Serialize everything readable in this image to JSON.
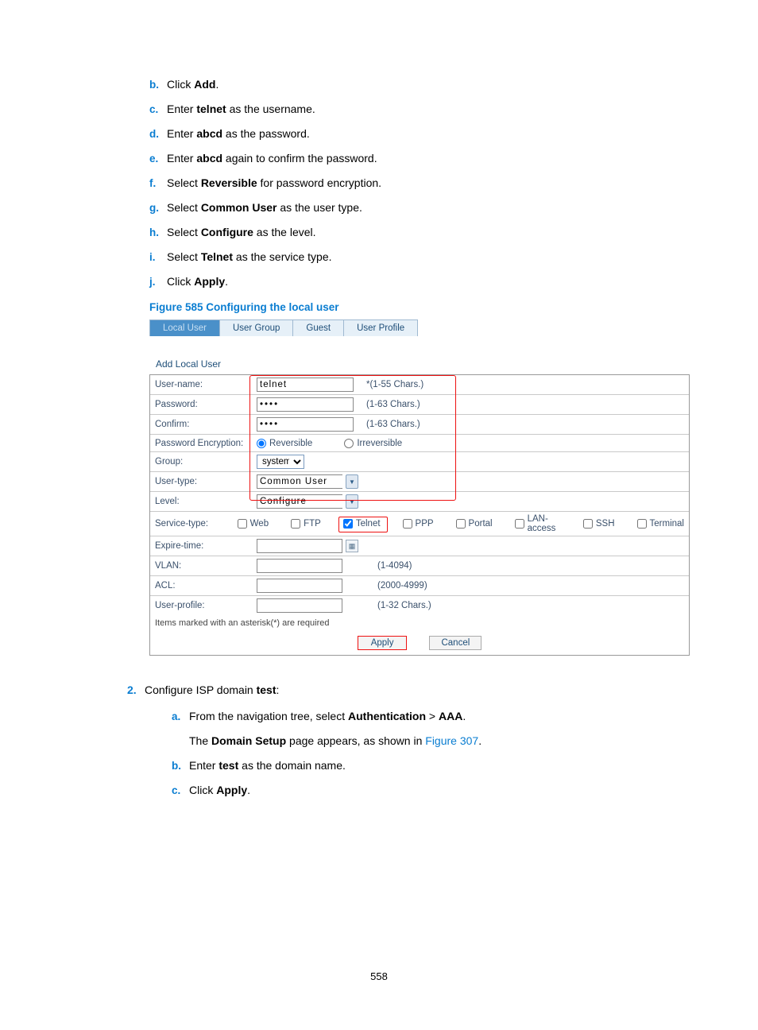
{
  "steps_first": [
    {
      "marker": "b.",
      "pre": "Click ",
      "bold": "Add",
      "post": "."
    },
    {
      "marker": "c.",
      "pre": "Enter ",
      "bold": "telnet",
      "post": " as the username."
    },
    {
      "marker": "d.",
      "pre": "Enter ",
      "bold": "abcd",
      "post": " as the password."
    },
    {
      "marker": "e.",
      "pre": "Enter ",
      "bold": "abcd",
      "post": " again to confirm the password."
    },
    {
      "marker": "f.",
      "pre": "Select ",
      "bold": "Reversible",
      "post": " for password encryption."
    },
    {
      "marker": "g.",
      "pre": "Select ",
      "bold": "Common User",
      "post": " as the user type."
    },
    {
      "marker": "h.",
      "pre": "Select ",
      "bold": "Configure",
      "post": " as the level."
    },
    {
      "marker": "i.",
      "pre": "Select ",
      "bold": "Telnet",
      "post": " as the service type."
    },
    {
      "marker": "j.",
      "pre": "Click ",
      "bold": "Apply",
      "post": "."
    }
  ],
  "figure_caption": "Figure 585 Configuring the local user",
  "tabs": {
    "active": "Local User",
    "others": [
      "User Group",
      "Guest",
      "User Profile"
    ]
  },
  "section_title": "Add Local User",
  "form": {
    "username": {
      "label": "User-name:",
      "value": "telnet",
      "hint": "*(1-55 Chars.)"
    },
    "password": {
      "label": "Password:",
      "value": "••••",
      "hint": "(1-63 Chars.)"
    },
    "confirm": {
      "label": "Confirm:",
      "value": "••••",
      "hint": "(1-63 Chars.)"
    },
    "encrypt": {
      "label": "Password Encryption:",
      "opt1": "Reversible",
      "opt2": "Irreversible"
    },
    "group": {
      "label": "Group:",
      "value": "system"
    },
    "usertype": {
      "label": "User-type:",
      "value": "Common User"
    },
    "level": {
      "label": "Level:",
      "value": "Configure"
    },
    "service": {
      "label": "Service-type:",
      "opts": [
        "Web",
        "FTP",
        "Telnet",
        "PPP",
        "Portal",
        "LAN-access",
        "SSH",
        "Terminal"
      ]
    },
    "expire": {
      "label": "Expire-time:"
    },
    "vlan": {
      "label": "VLAN:",
      "hint": "(1-4094)"
    },
    "acl": {
      "label": "ACL:",
      "hint": "(2000-4999)"
    },
    "profile": {
      "label": "User-profile:",
      "hint": "(1-32 Chars.)"
    }
  },
  "required_note": "Items marked with an asterisk(*) are required",
  "apply_label": "Apply",
  "cancel_label": "Cancel",
  "step2": {
    "num": "2.",
    "text_pre": "Configure ISP domain ",
    "text_bold": "test",
    "text_post": ":",
    "a_marker": "a.",
    "a_pre": "From the navigation tree, select ",
    "a_b1": "Authentication",
    "a_mid": " > ",
    "a_b2": "AAA",
    "a_post": ".",
    "a2_pre": "The ",
    "a2_bold": "Domain Setup",
    "a2_mid": " page appears, as shown in ",
    "a2_link": "Figure 307",
    "a2_post": ".",
    "b_marker": "b.",
    "b_pre": "Enter ",
    "b_bold": "test",
    "b_post": " as the domain name.",
    "c_marker": "c.",
    "c_pre": "Click ",
    "c_bold": "Apply",
    "c_post": "."
  },
  "page_number": "558"
}
